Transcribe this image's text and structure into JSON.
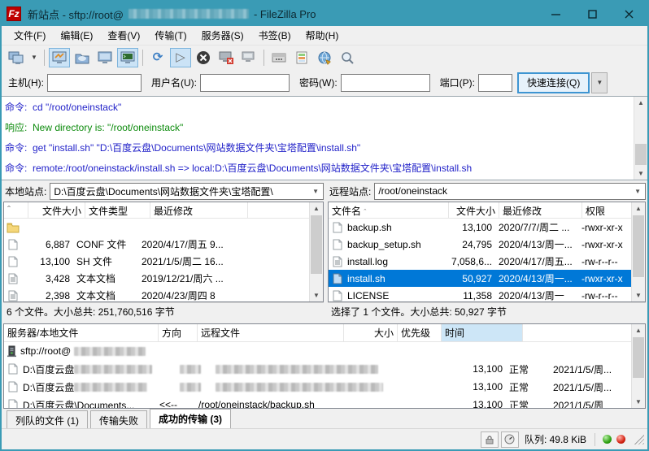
{
  "window": {
    "title_prefix": "新站点 - sftp://root@",
    "title_suffix": "- FileZilla Pro",
    "logo": "Fz"
  },
  "menu": {
    "items": [
      "文件(F)",
      "编辑(E)",
      "查看(V)",
      "传输(T)",
      "服务器(S)",
      "书签(B)",
      "帮助(H)"
    ]
  },
  "toolbar": {
    "icons": [
      "site-manager",
      "dropdown",
      "toggle-message-log",
      "toggle-local-tree",
      "toggle-remote-tree",
      "toggle-queue-view",
      "refresh",
      "process-queue",
      "cancel-operation",
      "disconnect",
      "reconnect",
      "directory-listing-filters",
      "directory-comparison",
      "synchronized-browsing",
      "search-files"
    ]
  },
  "quickconnect": {
    "host_label": "主机(H):",
    "user_label": "用户名(U):",
    "pass_label": "密码(W):",
    "port_label": "端口(P):",
    "button_label": "快速连接(Q)"
  },
  "log": {
    "lines": [
      {
        "label": "命令:",
        "text": "cd \"/root/oneinstack\"",
        "color": "blue"
      },
      {
        "label": "响应:",
        "text": "New directory is: \"/root/oneinstack\"",
        "color": "green"
      },
      {
        "label": "命令:",
        "text": "get \"install.sh\" \"D:\\百度云盘\\Documents\\网站数据文件夹\\宝塔配置\\install.sh\"",
        "color": "blue"
      },
      {
        "label": "命令:",
        "text": "remote:/root/oneinstack/install.sh => local:D:\\百度云盘\\Documents\\网站数据文件夹\\宝塔配置\\install.sh",
        "color": "blue"
      }
    ]
  },
  "local": {
    "site_label": "本地站点:",
    "path": "D:\\百度云盘\\Documents\\网站数据文件夹\\宝塔配置\\",
    "columns": [
      "文件大小",
      "文件类型",
      "最近修改"
    ],
    "rows": [
      {
        "icon": "folder",
        "size": "",
        "type": "",
        "date": ""
      },
      {
        "icon": "file",
        "size": "6,887",
        "type": "CONF 文件",
        "date": "2020/4/17/周五 9..."
      },
      {
        "icon": "file",
        "size": "13,100",
        "type": "SH 文件",
        "date": "2021/1/5/周二 16..."
      },
      {
        "icon": "text",
        "size": "3,428",
        "type": "文本文档",
        "date": "2019/12/21/周六 ..."
      },
      {
        "icon": "text",
        "size": "2,398",
        "type": "文本文档",
        "date": "2020/4/23/周四 8"
      }
    ],
    "status": "6 个文件。大小总共: 251,760,516 字节"
  },
  "remote": {
    "site_label": "远程站点:",
    "path": "/root/oneinstack",
    "columns": [
      "文件名",
      "文件大小",
      "最近修改",
      "权限"
    ],
    "rows": [
      {
        "icon": "file",
        "name": "backup.sh",
        "size": "13,100",
        "date": "2020/7/7/周二 ...",
        "perm": "-rwxr-xr-x"
      },
      {
        "icon": "file",
        "name": "backup_setup.sh",
        "size": "24,795",
        "date": "2020/4/13/周一...",
        "perm": "-rwxr-xr-x"
      },
      {
        "icon": "text",
        "name": "install.log",
        "size": "7,058,6...",
        "date": "2020/4/17/周五...",
        "perm": "-rw-r--r--"
      },
      {
        "icon": "file",
        "name": "install.sh",
        "size": "50,927",
        "date": "2020/4/13/周一...",
        "perm": "-rwxr-xr-x"
      },
      {
        "icon": "file",
        "name": "LICENSE",
        "size": "11,358",
        "date": "2020/4/13/周一",
        "perm": "-rw-r--r--"
      }
    ],
    "status": "选择了 1 个文件。大小总共: 50,927 字节"
  },
  "queue": {
    "columns": [
      "服务器/本地文件",
      "方向",
      "远程文件",
      "大小",
      "优先级",
      "时间"
    ],
    "rows": [
      {
        "kind": "server",
        "local": "sftp://root@",
        "direction": "",
        "remote": "",
        "size": "",
        "priority": "",
        "time": ""
      },
      {
        "kind": "file",
        "local": "D:\\百度云盘",
        "direction": "",
        "remote": "",
        "size": "13,100",
        "priority": "正常",
        "time": "2021/1/5/周..."
      },
      {
        "kind": "file",
        "local": "D:\\百度云盘",
        "direction": "",
        "remote": "",
        "size": "13,100",
        "priority": "正常",
        "time": "2021/1/5/周..."
      },
      {
        "kind": "file",
        "local": "D:\\百度云盘\\Documents...",
        "direction": "<<--",
        "remote": "/root/oneinstack/backup.sh",
        "size": "13,100",
        "priority": "正常",
        "time": "2021/1/5/周"
      }
    ],
    "tabs": [
      {
        "label": "列队的文件 (1)",
        "active": false
      },
      {
        "label": "传输失败",
        "active": false
      },
      {
        "label": "成功的传输 (3)",
        "active": true
      }
    ]
  },
  "statusbar": {
    "queue_text": "队列: 49.8 KiB"
  }
}
